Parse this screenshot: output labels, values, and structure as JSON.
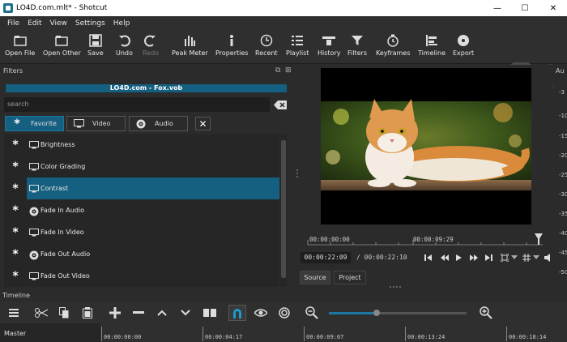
{
  "window": {
    "title": "LO4D.com.mlt* - Shotcut",
    "minimize": "—",
    "maximize": "☐",
    "close": "✕"
  },
  "menu": [
    "File",
    "Edit",
    "View",
    "Settings",
    "Help"
  ],
  "toolbar": [
    {
      "label": "Open File",
      "icon": "open-file-icon"
    },
    {
      "label": "Open Other",
      "icon": "open-other-icon"
    },
    {
      "label": "Save",
      "icon": "save-icon"
    },
    {
      "label": "Undo",
      "icon": "undo-icon"
    },
    {
      "label": "Redo",
      "icon": "redo-icon",
      "disabled": true
    },
    {
      "label": "Peak Meter",
      "icon": "peak-meter-icon"
    },
    {
      "label": "Properties",
      "icon": "properties-icon"
    },
    {
      "label": "Recent",
      "icon": "recent-icon"
    },
    {
      "label": "Playlist",
      "icon": "playlist-icon"
    },
    {
      "label": "History",
      "icon": "history-icon"
    },
    {
      "label": "Filters",
      "icon": "filters-icon"
    },
    {
      "label": "Keyframes",
      "icon": "keyframes-icon"
    },
    {
      "label": "Timeline",
      "icon": "timeline-icon"
    },
    {
      "label": "Export",
      "icon": "export-icon"
    }
  ],
  "filters_panel": {
    "title": "Filters",
    "clip_name": "LO4D.com - Fox.vob",
    "search_placeholder": "search",
    "tabs": [
      {
        "label": "Favorite",
        "active": true
      },
      {
        "label": "Video",
        "active": false
      },
      {
        "label": "Audio",
        "active": false
      }
    ],
    "items": [
      {
        "name": "Brightness",
        "type": "video",
        "selected": false
      },
      {
        "name": "Color Grading",
        "type": "video",
        "selected": false
      },
      {
        "name": "Contrast",
        "type": "video",
        "selected": true
      },
      {
        "name": "Fade In Audio",
        "type": "audio",
        "selected": false
      },
      {
        "name": "Fade In Video",
        "type": "video",
        "selected": false
      },
      {
        "name": "Fade Out Audio",
        "type": "audio",
        "selected": false
      },
      {
        "name": "Fade Out Video",
        "type": "video",
        "selected": false
      }
    ]
  },
  "player": {
    "scale_start": "00:00:00:00",
    "scale_mid": "00:00:09:29",
    "current_time": "00:00:22:09",
    "duration": "/ 00:00:22:10",
    "tabs": [
      {
        "label": "Source",
        "active": true
      },
      {
        "label": "Project",
        "active": false
      }
    ]
  },
  "audio_meter": {
    "label": "Au",
    "ticks": [
      "-3",
      "-10",
      "-15",
      "-20",
      "-25",
      "-30",
      "-35",
      "-40",
      "-45",
      "-50"
    ]
  },
  "timeline": {
    "title": "Timeline",
    "track_label": "Master",
    "ruler": [
      "00:00:00:00",
      "00:00:04:17",
      "00:00:09:07",
      "00:00:13:24",
      "00:00:18:14"
    ]
  },
  "colors": {
    "accent": "#155f80",
    "background": "#2b2b2b"
  }
}
